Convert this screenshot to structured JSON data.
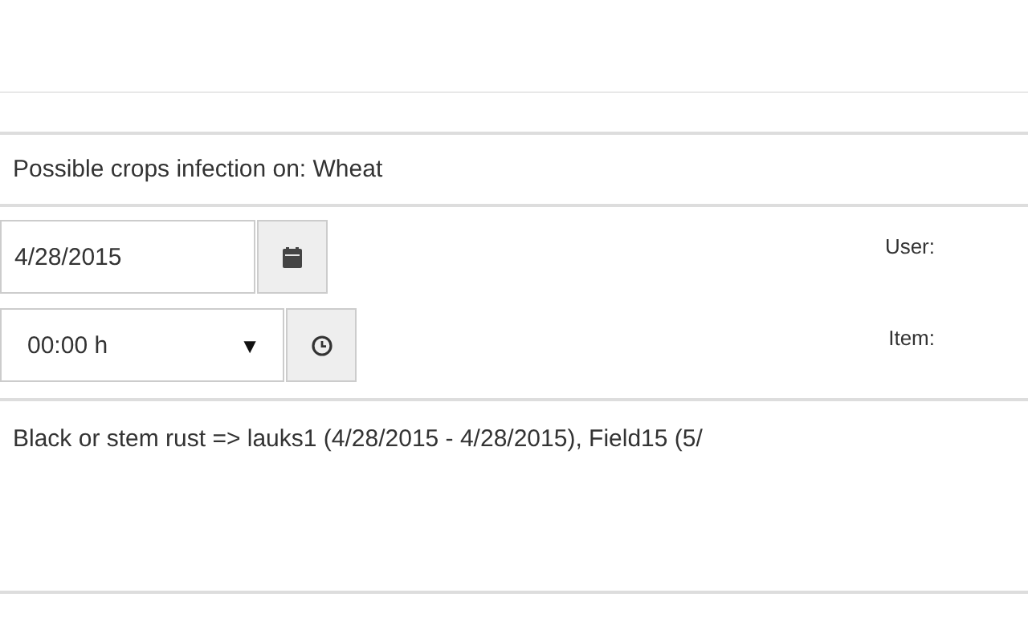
{
  "header": {
    "title": "Possible crops infection on: Wheat"
  },
  "date_field": {
    "value": "4/28/2015"
  },
  "time_select": {
    "value": "00:00 h",
    "arrow": "▼"
  },
  "labels": [
    "User:",
    "Item:"
  ],
  "message": "Black or stem rust => lauks1 (4/28/2015 - 4/28/2015), Field15 (5/"
}
